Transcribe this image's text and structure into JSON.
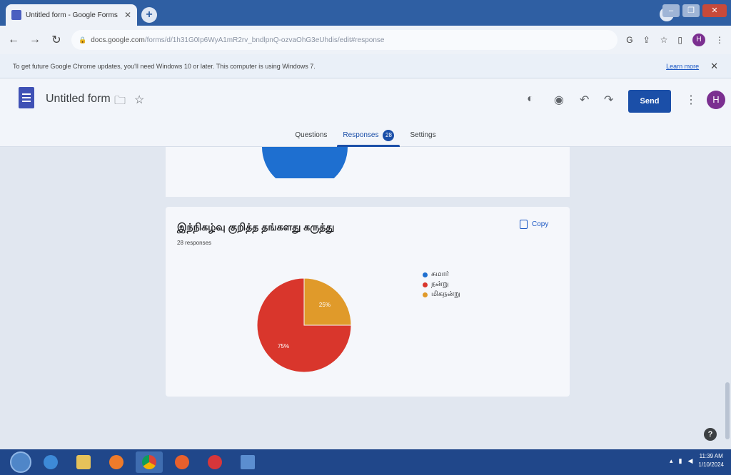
{
  "browser": {
    "tab_title": "Untitled form - Google Forms",
    "url_host": "docs.google.com",
    "url_path": "/forms/d/1h31G0Ip6WyA1mR2rv_bndlpnQ-ozvaOhG3eUhdis/edit#response",
    "infobar_message": "To get future Google Chrome updates, you'll need Windows 10 or later. This computer is using Windows 7.",
    "infobar_link": "Learn more"
  },
  "form": {
    "title": "Untitled form",
    "send_label": "Send",
    "avatar_letter": "H",
    "tabs": [
      {
        "label": "Questions"
      },
      {
        "label": "Responses",
        "badge": "28"
      },
      {
        "label": "Settings"
      }
    ]
  },
  "question": {
    "title": "இந்நிகழ்வு குறித்த தங்களது கருத்து",
    "response_count": "28 responses",
    "copy_label": "Copy"
  },
  "chart_data": {
    "type": "pie",
    "title": "இந்நிகழ்வு குறித்த தங்களது கருத்து",
    "subtitle": "28 responses",
    "legend_position": "right",
    "slices": [
      {
        "label": "சுமார்",
        "value": 0,
        "color": "#1e6fd0",
        "display": ""
      },
      {
        "label": "நன்று",
        "value": 75,
        "color": "#d9362c",
        "display": "75%"
      },
      {
        "label": "மிகநன்று",
        "value": 25,
        "color": "#e09a2a",
        "display": "25%"
      }
    ]
  },
  "taskbar": {
    "time": "11:39 AM",
    "date": "1/10/2024"
  },
  "colors": {
    "accent": "#1b4fa8",
    "forms_purple": "#3f51b5",
    "avatar": "#7b2f90"
  }
}
